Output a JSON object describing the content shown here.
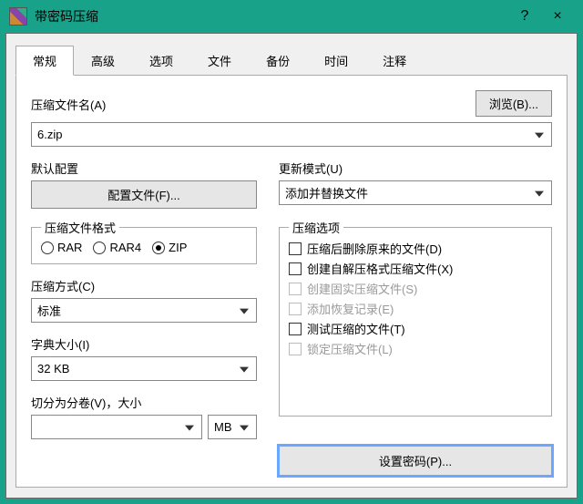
{
  "window": {
    "title": "带密码压缩",
    "help": "?",
    "close": "×"
  },
  "tabs": {
    "general": "常规",
    "advanced": "高级",
    "options": "选项",
    "files": "文件",
    "backup": "备份",
    "time": "时间",
    "comment": "注释",
    "active": "general"
  },
  "archiveName": {
    "label": "压缩文件名(A)",
    "value": "6.zip",
    "browse": "浏览(B)..."
  },
  "defaultProfile": {
    "label": "默认配置",
    "button": "配置文件(F)..."
  },
  "updateMode": {
    "label": "更新模式(U)",
    "value": "添加并替换文件"
  },
  "format": {
    "label": "压缩文件格式",
    "options": {
      "rar": "RAR",
      "rar4": "RAR4",
      "zip": "ZIP"
    },
    "selected": "zip"
  },
  "method": {
    "label": "压缩方式(C)",
    "value": "标准"
  },
  "dict": {
    "label": "字典大小(I)",
    "value": "32 KB"
  },
  "split": {
    "label": "切分为分卷(V)，大小",
    "value": "",
    "unit": "MB"
  },
  "compressOptions": {
    "legend": "压缩选项",
    "items": {
      "deleteAfter": "压缩后删除原来的文件(D)",
      "sfx": "创建自解压格式压缩文件(X)",
      "solid": "创建固实压缩文件(S)",
      "recovery": "添加恢复记录(E)",
      "test": "测试压缩的文件(T)",
      "lock": "锁定压缩文件(L)"
    }
  },
  "password": {
    "button": "设置密码(P)..."
  }
}
